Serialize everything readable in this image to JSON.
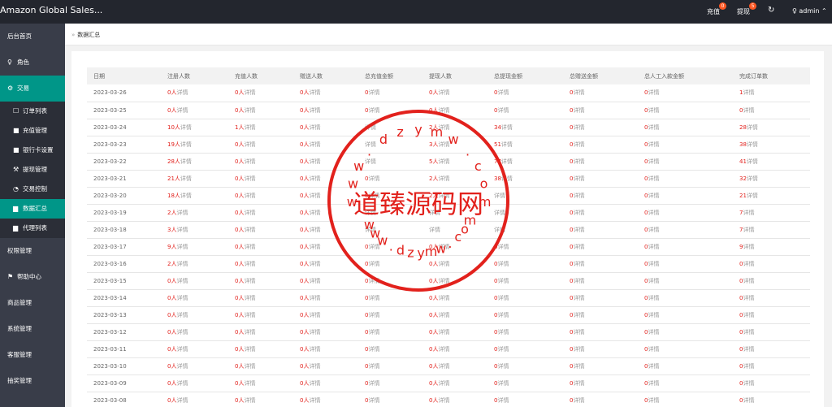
{
  "topbar": {
    "brand": "Amazon Global Sales...",
    "recharge_label": "充值",
    "recharge_badge": "0",
    "withdraw_label": "提现",
    "withdraw_badge": "5",
    "refresh_icon": "refresh-icon",
    "user_icon": "user-icon",
    "username": "admin",
    "chevron_icon": "chevron-up-icon"
  },
  "sidebar": {
    "items": [
      {
        "label": "后台首页"
      },
      {
        "label": "角色",
        "icon": "user-icon"
      },
      {
        "label": "交易",
        "icon": "gear-icon"
      },
      {
        "label": "订单列表",
        "icon": "cart-icon"
      },
      {
        "label": "充值管理",
        "icon": "chat-icon"
      },
      {
        "label": "银行卡设置",
        "icon": "chat-icon"
      },
      {
        "label": "提现管理",
        "icon": "wrench-icon"
      },
      {
        "label": "交易控制",
        "icon": "gauge-icon"
      },
      {
        "label": "数据汇总",
        "icon": "chart-icon"
      },
      {
        "label": "代理列表",
        "icon": "chart-icon"
      },
      {
        "label": "权限管理"
      },
      {
        "label": "帮助中心",
        "icon": "flag-icon"
      },
      {
        "label": "商品管理"
      },
      {
        "label": "系统管理"
      },
      {
        "label": "客服管理"
      },
      {
        "label": "抽奖管理"
      }
    ]
  },
  "breadcrumb": {
    "separator": "»",
    "current": "数据汇总"
  },
  "table": {
    "headers": [
      "日期",
      "注册人数",
      "充值人数",
      "赠送人数",
      "总充值金额",
      "提现人数",
      "总提现金额",
      "总赠送金额",
      "总人工入款金额",
      "完成订单数"
    ],
    "detail_label": "详情",
    "rows": [
      [
        "2023-03-26",
        "0人",
        "0人",
        "0人",
        "0",
        "0人",
        "0",
        "0",
        "0",
        "1"
      ],
      [
        "2023-03-25",
        "0人",
        "0人",
        "0人",
        "0",
        "0人",
        "0",
        "0",
        "0",
        "0"
      ],
      [
        "2023-03-24",
        "10人",
        "1人",
        "0人",
        "",
        "2人",
        "34",
        "0",
        "0",
        "28"
      ],
      [
        "2023-03-23",
        "19人",
        "0人",
        "0人",
        "",
        "3人",
        "51",
        "0",
        "0",
        "38"
      ],
      [
        "2023-03-22",
        "28人",
        "0人",
        "0人",
        "",
        "5人",
        "77",
        "0",
        "0",
        "41"
      ],
      [
        "2023-03-21",
        "21人",
        "0人",
        "0人",
        "0",
        "2人",
        "38",
        "0",
        "0",
        "32"
      ],
      [
        "2023-03-20",
        "18人",
        "0人",
        "0人",
        "0",
        "2人",
        "",
        "0",
        "0",
        "21"
      ],
      [
        "2023-03-19",
        "2人",
        "0人",
        "0人",
        "",
        "",
        "",
        "0",
        "0",
        "7"
      ],
      [
        "2023-03-18",
        "3人",
        "0人",
        "0人",
        "",
        "",
        "",
        "0",
        "0",
        "7"
      ],
      [
        "2023-03-17",
        "9人",
        "0人",
        "0人",
        "0",
        "0人",
        "0",
        "0",
        "0",
        "9"
      ],
      [
        "2023-03-16",
        "2人",
        "0人",
        "0人",
        "0",
        "0人",
        "0",
        "0",
        "0",
        "0"
      ],
      [
        "2023-03-15",
        "0人",
        "0人",
        "0人",
        "0",
        "0人",
        "0",
        "0",
        "0",
        "0"
      ],
      [
        "2023-03-14",
        "0人",
        "0人",
        "0人",
        "0",
        "0人",
        "0",
        "0",
        "0",
        "0"
      ],
      [
        "2023-03-13",
        "0人",
        "0人",
        "0人",
        "0",
        "0人",
        "0",
        "0",
        "0",
        "0"
      ],
      [
        "2023-03-12",
        "0人",
        "0人",
        "0人",
        "0",
        "0人",
        "0",
        "0",
        "0",
        "0"
      ],
      [
        "2023-03-11",
        "0人",
        "0人",
        "0人",
        "0",
        "0人",
        "0",
        "0",
        "0",
        "0"
      ],
      [
        "2023-03-10",
        "0人",
        "0人",
        "0人",
        "0",
        "0人",
        "0",
        "0",
        "0",
        "0"
      ],
      [
        "2023-03-09",
        "0人",
        "0人",
        "0人",
        "0",
        "0人",
        "0",
        "0",
        "0",
        "0"
      ],
      [
        "2023-03-08",
        "0人",
        "0人",
        "0人",
        "0",
        "0人",
        "0",
        "0",
        "0",
        "0"
      ]
    ]
  },
  "watermark": {
    "text": "道臻源码网",
    "url_top": "www.dzymw.com",
    "url_bottom": "www.dzymw.com",
    "color": "#e2211c"
  },
  "colors": {
    "accent": "#009688",
    "topbar": "#23262e",
    "sidebar": "#393d49",
    "value": "#e2211c",
    "badge": "#ff5722"
  }
}
